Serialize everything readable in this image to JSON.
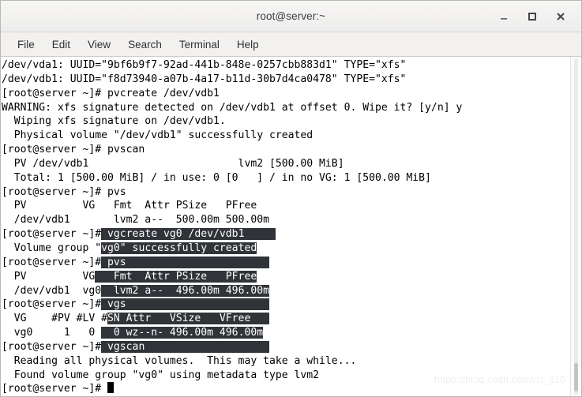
{
  "window": {
    "title": "root@server:~",
    "controls": [
      {
        "name": "minimize",
        "label": "–"
      },
      {
        "name": "maximize",
        "label": "□"
      },
      {
        "name": "close",
        "label": "×"
      }
    ]
  },
  "menubar": {
    "items": [
      {
        "label": "File"
      },
      {
        "label": "Edit"
      },
      {
        "label": "View"
      },
      {
        "label": "Search"
      },
      {
        "label": "Terminal"
      },
      {
        "label": "Help"
      }
    ]
  },
  "terminal": {
    "prompt": "[root@server ~]#",
    "selection_color": "#303338",
    "selection_text_color": "#ffffff",
    "background_color": "#ffffff",
    "foreground_color": "#000000",
    "cursor": {
      "shape": "block",
      "color": "#000000"
    },
    "lines": [
      {
        "id": "l1",
        "text": "/dev/vda1: UUID=\"9bf6b9f7-92ad-441b-848e-0257cbb883d1\" TYPE=\"xfs\"",
        "selected": false
      },
      {
        "id": "l2",
        "text": "/dev/vdb1: UUID=\"f8d73940-a07b-4a17-b11d-30b7d4ca0478\" TYPE=\"xfs\"",
        "selected": false
      },
      {
        "id": "l3",
        "text": "[root@server ~]# pvcreate /dev/vdb1",
        "selected": false
      },
      {
        "id": "l4",
        "text": "WARNING: xfs signature detected on /dev/vdb1 at offset 0. Wipe it? [y/n] y",
        "selected": false
      },
      {
        "id": "l5",
        "text": "  Wiping xfs signature on /dev/vdb1.",
        "selected": false
      },
      {
        "id": "l6",
        "text": "  Physical volume \"/dev/vdb1\" successfully created",
        "selected": false
      },
      {
        "id": "l7",
        "text": "[root@server ~]# pvscan",
        "selected": false
      },
      {
        "id": "l8",
        "text": "  PV /dev/vdb1                        lvm2 [500.00 MiB]",
        "selected": false
      },
      {
        "id": "l9",
        "text": "  Total: 1 [500.00 MiB] / in use: 0 [0   ] / in no VG: 1 [500.00 MiB]",
        "selected": false
      },
      {
        "id": "l10",
        "text": "[root@server ~]# pvs",
        "selected": false
      },
      {
        "id": "l11",
        "text": "  PV         VG   Fmt  Attr PSize   PFree",
        "selected": false
      },
      {
        "id": "l12",
        "text": "  /dev/vdb1       lvm2 a--  500.00m 500.00m",
        "selected": false
      },
      {
        "id": "l13",
        "prefix": "[root@server ~]#",
        "selected_text": " vgcreate vg0 /dev/vdb1     ",
        "selected": true
      },
      {
        "id": "l14",
        "prefix": "  Volume group \"",
        "selected_text": "vg0\" successfully created",
        "selected": true
      },
      {
        "id": "l15",
        "prefix": "[root@server ~]#",
        "selected_text": " pvs                       ",
        "selected": true
      },
      {
        "id": "l16",
        "prefix": "  PV         VG",
        "selected_text": "   Fmt  Attr PSize   PFree",
        "selected": true
      },
      {
        "id": "l17",
        "prefix": "  /dev/vdb1  vg0",
        "selected_text": "  lvm2 a--  496.00m 496.00m",
        "selected": true
      },
      {
        "id": "l18",
        "prefix": "[root@server ~]#",
        "selected_text": " vgs                       ",
        "selected": true
      },
      {
        "id": "l19",
        "prefix": "  VG    #PV #LV #",
        "selected_text": "SN Attr   VSize   VFree   ",
        "selected": true
      },
      {
        "id": "l20",
        "prefix": "  vg0     1   0 ",
        "selected_text": "  0 wz--n- 496.00m 496.00m",
        "selected": true
      },
      {
        "id": "l21",
        "prefix": "[root@server ~]#",
        "selected_text": " vgscan                    ",
        "selected": true
      },
      {
        "id": "l22",
        "text": "  Reading all physical volumes.  This may take a while...",
        "selected": false
      },
      {
        "id": "l23",
        "text": "  Found volume group \"vg0\" using metadata type lvm2",
        "selected": false
      },
      {
        "id": "l24",
        "text": "[root@server ~]# ",
        "selected": false,
        "cursor": true
      }
    ]
  },
  "watermark": {
    "text": "https://blog.csdn.net/wzj_110"
  }
}
